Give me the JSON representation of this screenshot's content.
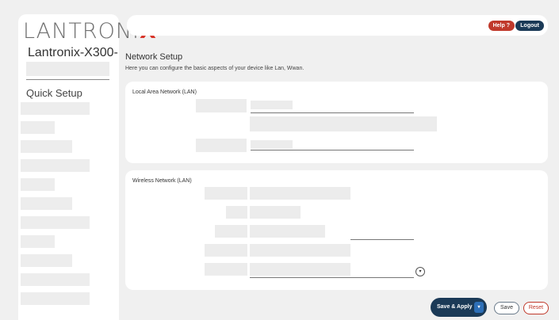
{
  "brand": {
    "logo_text": "LANTRONI",
    "logo_x": "X"
  },
  "device": {
    "name": "Lantronix-X300-"
  },
  "sidebar": {
    "quick_setup_label": "Quick Setup"
  },
  "header": {
    "help_label": "Help ?",
    "logout_label": "Logout"
  },
  "page": {
    "title": "Network Setup",
    "subtitle": "Here you can configure the basic aspects of your device like Lan, Wwan."
  },
  "sections": {
    "lan": {
      "title": "Local Area Network (LAN)"
    },
    "wlan": {
      "title": "Wireless Network (LAN)"
    }
  },
  "actions": {
    "save_apply_label": "Save & Apply",
    "save_apply_arrow": "▾",
    "save_label": "Save",
    "reset_label": "Reset"
  },
  "colors": {
    "accent_dark": "#1b3a57",
    "danger": "#c0392b",
    "brand_x": "#d8352a"
  }
}
